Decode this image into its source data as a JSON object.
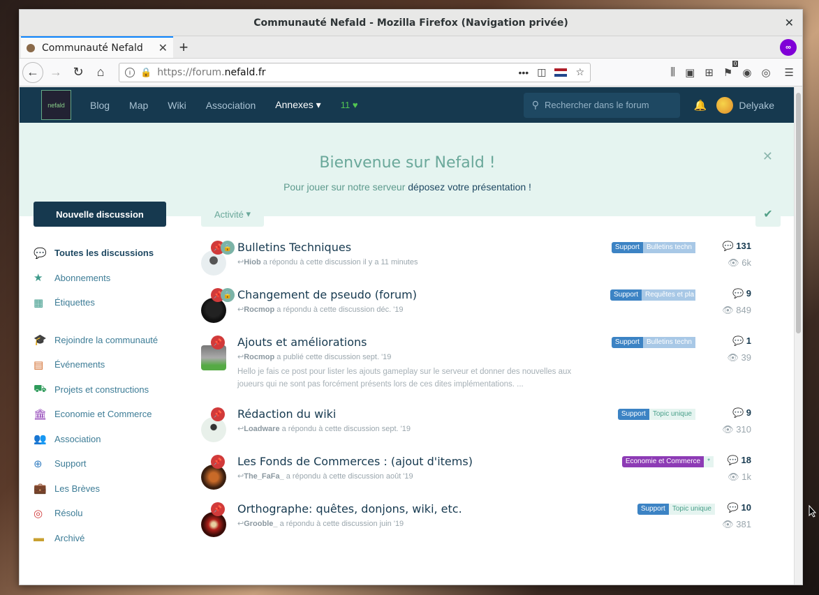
{
  "window": {
    "title": "Communauté Nefald - Mozilla Firefox (Navigation privée)"
  },
  "tab": {
    "title": "Communauté Nefald"
  },
  "urlbar": {
    "prefix": "https://forum.",
    "domain": "nefald.fr",
    "badge_count": "0"
  },
  "site": {
    "logo_text": "nefald",
    "nav": [
      "Blog",
      "Map",
      "Wiki",
      "Association"
    ],
    "annexes": "Annexes",
    "online": "11",
    "search_placeholder": "Rechercher dans le forum",
    "username": "Delyake"
  },
  "hero": {
    "title": "Bienvenue sur Nefald !",
    "text_prefix": "Pour jouer sur notre serveur ",
    "link": "déposez votre présentation !"
  },
  "sidebar": {
    "new_button": "Nouvelle discussion",
    "items": [
      {
        "label": "Toutes les discussions",
        "icon": "comments-icon",
        "color": "#1e4862"
      },
      {
        "label": "Abonnements",
        "icon": "star-icon",
        "color": "#3d9a8a"
      },
      {
        "label": "Étiquettes",
        "icon": "grid-icon",
        "color": "#3d9a8a"
      }
    ],
    "categories": [
      {
        "label": "Rejoindre la communauté",
        "icon": "graduation-icon",
        "color": "#3c83c4"
      },
      {
        "label": "Événements",
        "icon": "calendar-icon",
        "color": "#d26a2a"
      },
      {
        "label": "Projets et constructions",
        "icon": "car-icon",
        "color": "#2e9a5a"
      },
      {
        "label": "Economie et Commerce",
        "icon": "bank-icon",
        "color": "#8d3bb5"
      },
      {
        "label": "Association",
        "icon": "users-icon",
        "color": "#3aa65a"
      },
      {
        "label": "Support",
        "icon": "lifebuoy-icon",
        "color": "#3c83c4"
      },
      {
        "label": "Les Brèves",
        "icon": "briefcase-icon",
        "color": "#2e8a8a"
      },
      {
        "label": "Résolu",
        "icon": "target-icon",
        "color": "#d13a3a"
      },
      {
        "label": "Archivé",
        "icon": "archive-icon",
        "color": "#c8a030"
      }
    ]
  },
  "toolbar": {
    "sort": "Activité"
  },
  "discussions": [
    {
      "title": "Bulletins Techniques",
      "user": "Hiob",
      "action": " a répondu à cette discussion il y a 11 minutes",
      "tags": [
        "Support",
        "Bulletins techn"
      ],
      "replies": "131",
      "views": "6k"
    },
    {
      "title": "Changement de pseudo (forum)",
      "user": "Rocmop",
      "action": " a répondu à cette discussion déc. '19",
      "tags": [
        "Support",
        "Requêtes et pla"
      ],
      "replies": "9",
      "views": "849"
    },
    {
      "title": "Ajouts et améliorations",
      "user": "Rocmop",
      "action": " a publié cette discussion sept. '19",
      "excerpt": "Hello je fais ce post pour lister les ajouts gameplay sur le serveur et donner des nouvelles aux joueurs qui ne sont pas forcément présents lors de ces dites implémentations. ...",
      "tags": [
        "Support",
        "Bulletins techn"
      ],
      "replies": "1",
      "views": "39"
    },
    {
      "title": "Rédaction du wiki",
      "user": "Loadware",
      "action": " a répondu à cette discussion sept. '19",
      "tags": [
        "Support",
        "Topic unique"
      ],
      "replies": "9",
      "views": "310"
    },
    {
      "title": "Les Fonds de Commerces : (ajout d'items)",
      "user": "The_FaFa_",
      "action": " a répondu à cette discussion août '19",
      "tags": [
        "Economie et Commerce",
        "*"
      ],
      "replies": "18",
      "views": "1k"
    },
    {
      "title": "Orthographe: quêtes, donjons, wiki, etc.",
      "user": "Grooble_",
      "action": " a répondu à cette discussion juin '19",
      "tags": [
        "Support",
        "Topic unique"
      ],
      "replies": "10",
      "views": "381"
    }
  ]
}
